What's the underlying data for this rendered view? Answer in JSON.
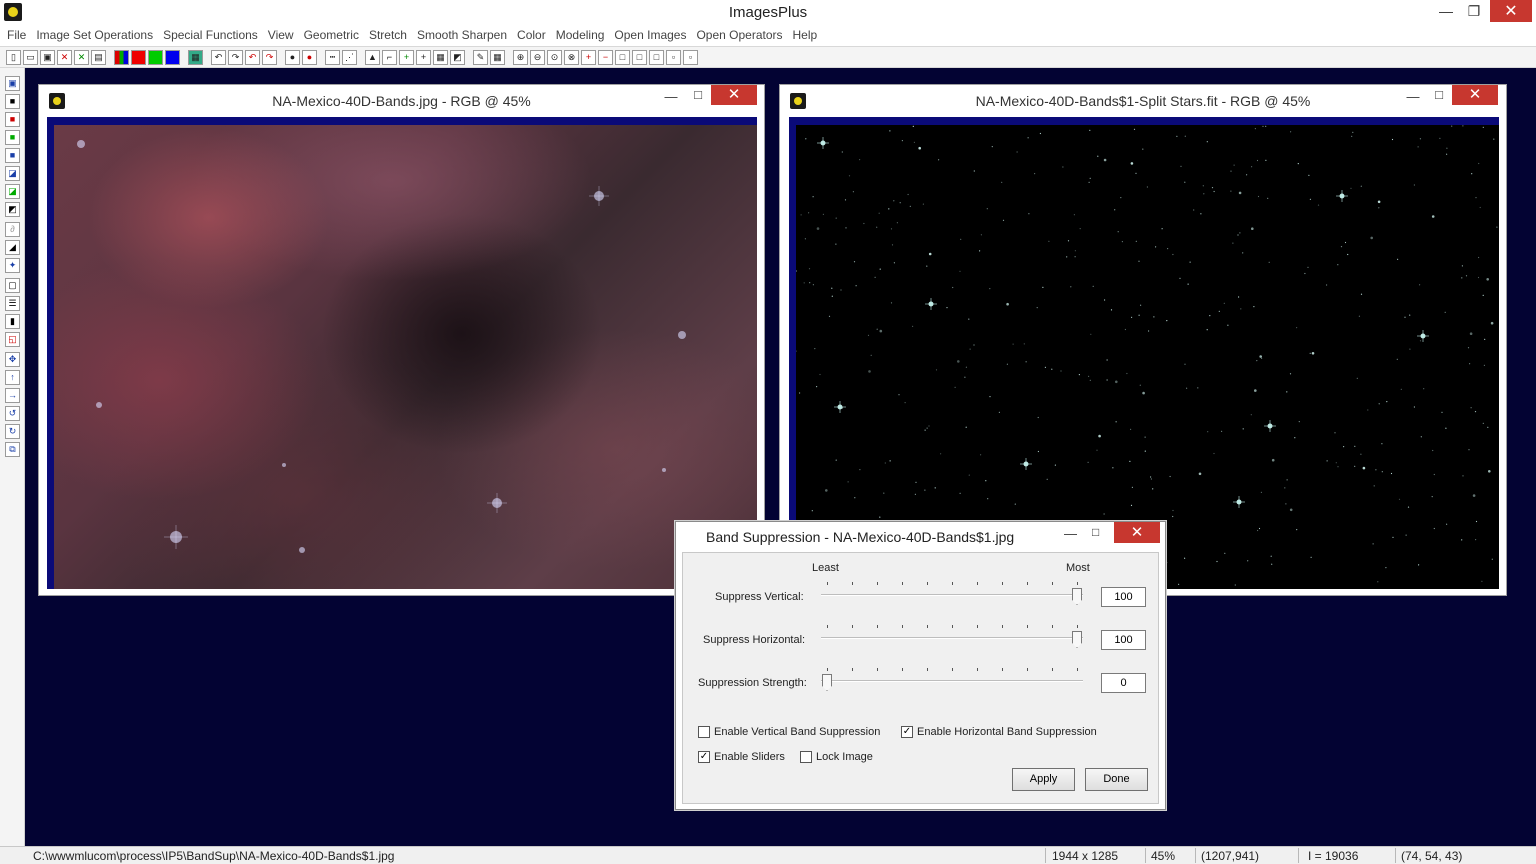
{
  "app": {
    "title": "ImagesPlus"
  },
  "menu": [
    "File",
    "Image Set Operations",
    "Special Functions",
    "View",
    "Geometric",
    "Stretch",
    "Smooth Sharpen",
    "Color",
    "Modeling",
    "Open Images",
    "Open Operators",
    "Help"
  ],
  "windows": {
    "left_title": "NA-Mexico-40D-Bands.jpg - RGB @ 45%",
    "right_title": "NA-Mexico-40D-Bands$1-Split Stars.fit - RGB @ 45%"
  },
  "dialog": {
    "title": "Band Suppression - NA-Mexico-40D-Bands$1.jpg",
    "scale_least": "Least",
    "scale_most": "Most",
    "sliders": [
      {
        "label": "Suppress Vertical:",
        "value": "100",
        "position": 1.0
      },
      {
        "label": "Suppress Horizontal:",
        "value": "100",
        "position": 1.0
      },
      {
        "label": "Suppression Strength:",
        "value": "0",
        "position": 0.0
      }
    ],
    "checkboxes": {
      "vertical": {
        "label": "Enable Vertical Band Suppression",
        "checked": false
      },
      "horizontal": {
        "label": "Enable Horizontal Band Suppression",
        "checked": true
      },
      "sliders": {
        "label": "Enable Sliders",
        "checked": true
      },
      "lock": {
        "label": "Lock Image",
        "checked": false
      }
    },
    "apply_label": "Apply",
    "done_label": "Done"
  },
  "status": {
    "path": "C:\\wwwmlucom\\process\\IP5\\BandSup\\NA-Mexico-40D-Bands$1.jpg",
    "dimensions": "1944 x 1285",
    "zoom": "45%",
    "cursor": "(1207,941)",
    "intensity": "I = 19036",
    "rgb": "(74, 54, 43)"
  },
  "colors": {
    "desktop": "#030333",
    "frame": "#0a0a78",
    "close": "#c7372f"
  }
}
